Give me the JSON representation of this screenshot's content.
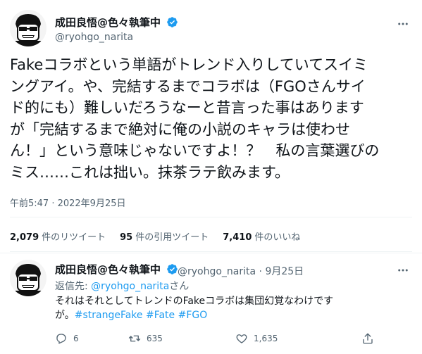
{
  "main_tweet": {
    "author_name": "成田良悟@色々執筆中",
    "handle": "@ryohgo_narita",
    "text_lines": [
      "Fakeコラボという単語がトレンド入りしていてスイミ",
      "ングアイ。や、完結するまでコラボは（FGOさんサイ",
      "ド的にも）難しいだろうなーと昔言った事はあります",
      "が「完結するまで絶対に俺の小説のキャラは使わせ",
      "ん！」という意味じゃないですよ！？　私の言葉選びの",
      "ミス……これは拙い。抹茶ラテ飲みます。"
    ],
    "timestamp": "午前5:47 · 2022年9月25日",
    "stats": {
      "retweets_count": "2,079",
      "retweets_label": "件のリツイート",
      "quotes_count": "95",
      "quotes_label": "件の引用ツイート",
      "likes_count": "7,410",
      "likes_label": "件のいいね"
    }
  },
  "reply_tweet": {
    "author_name": "成田良悟@色々執筆中",
    "meta": "@ryohgo_narita · 9月25日",
    "replying_prefix": "返信先: ",
    "replying_handle": "@ryohgo_narita",
    "replying_suffix": "さん",
    "text_line1": "それはそれとしてトレンドのFakeコラボは集団幻覚なわけです",
    "text_line2_prefix": "が。",
    "hashtags": [
      "#strangeFake",
      "#Fate",
      "#FGO"
    ],
    "actions": {
      "reply_count": "6",
      "retweet_count": "635",
      "like_count": "1,635"
    }
  },
  "icons": {
    "more": "more-horizontal-icon",
    "verified": "verified-badge-icon",
    "reply": "reply-icon",
    "retweet": "retweet-icon",
    "like": "heart-icon",
    "share": "share-icon"
  },
  "colors": {
    "accent": "#1d9bf0",
    "text_primary": "#0f1419",
    "text_secondary": "#536471",
    "divider": "#eff3f4"
  }
}
